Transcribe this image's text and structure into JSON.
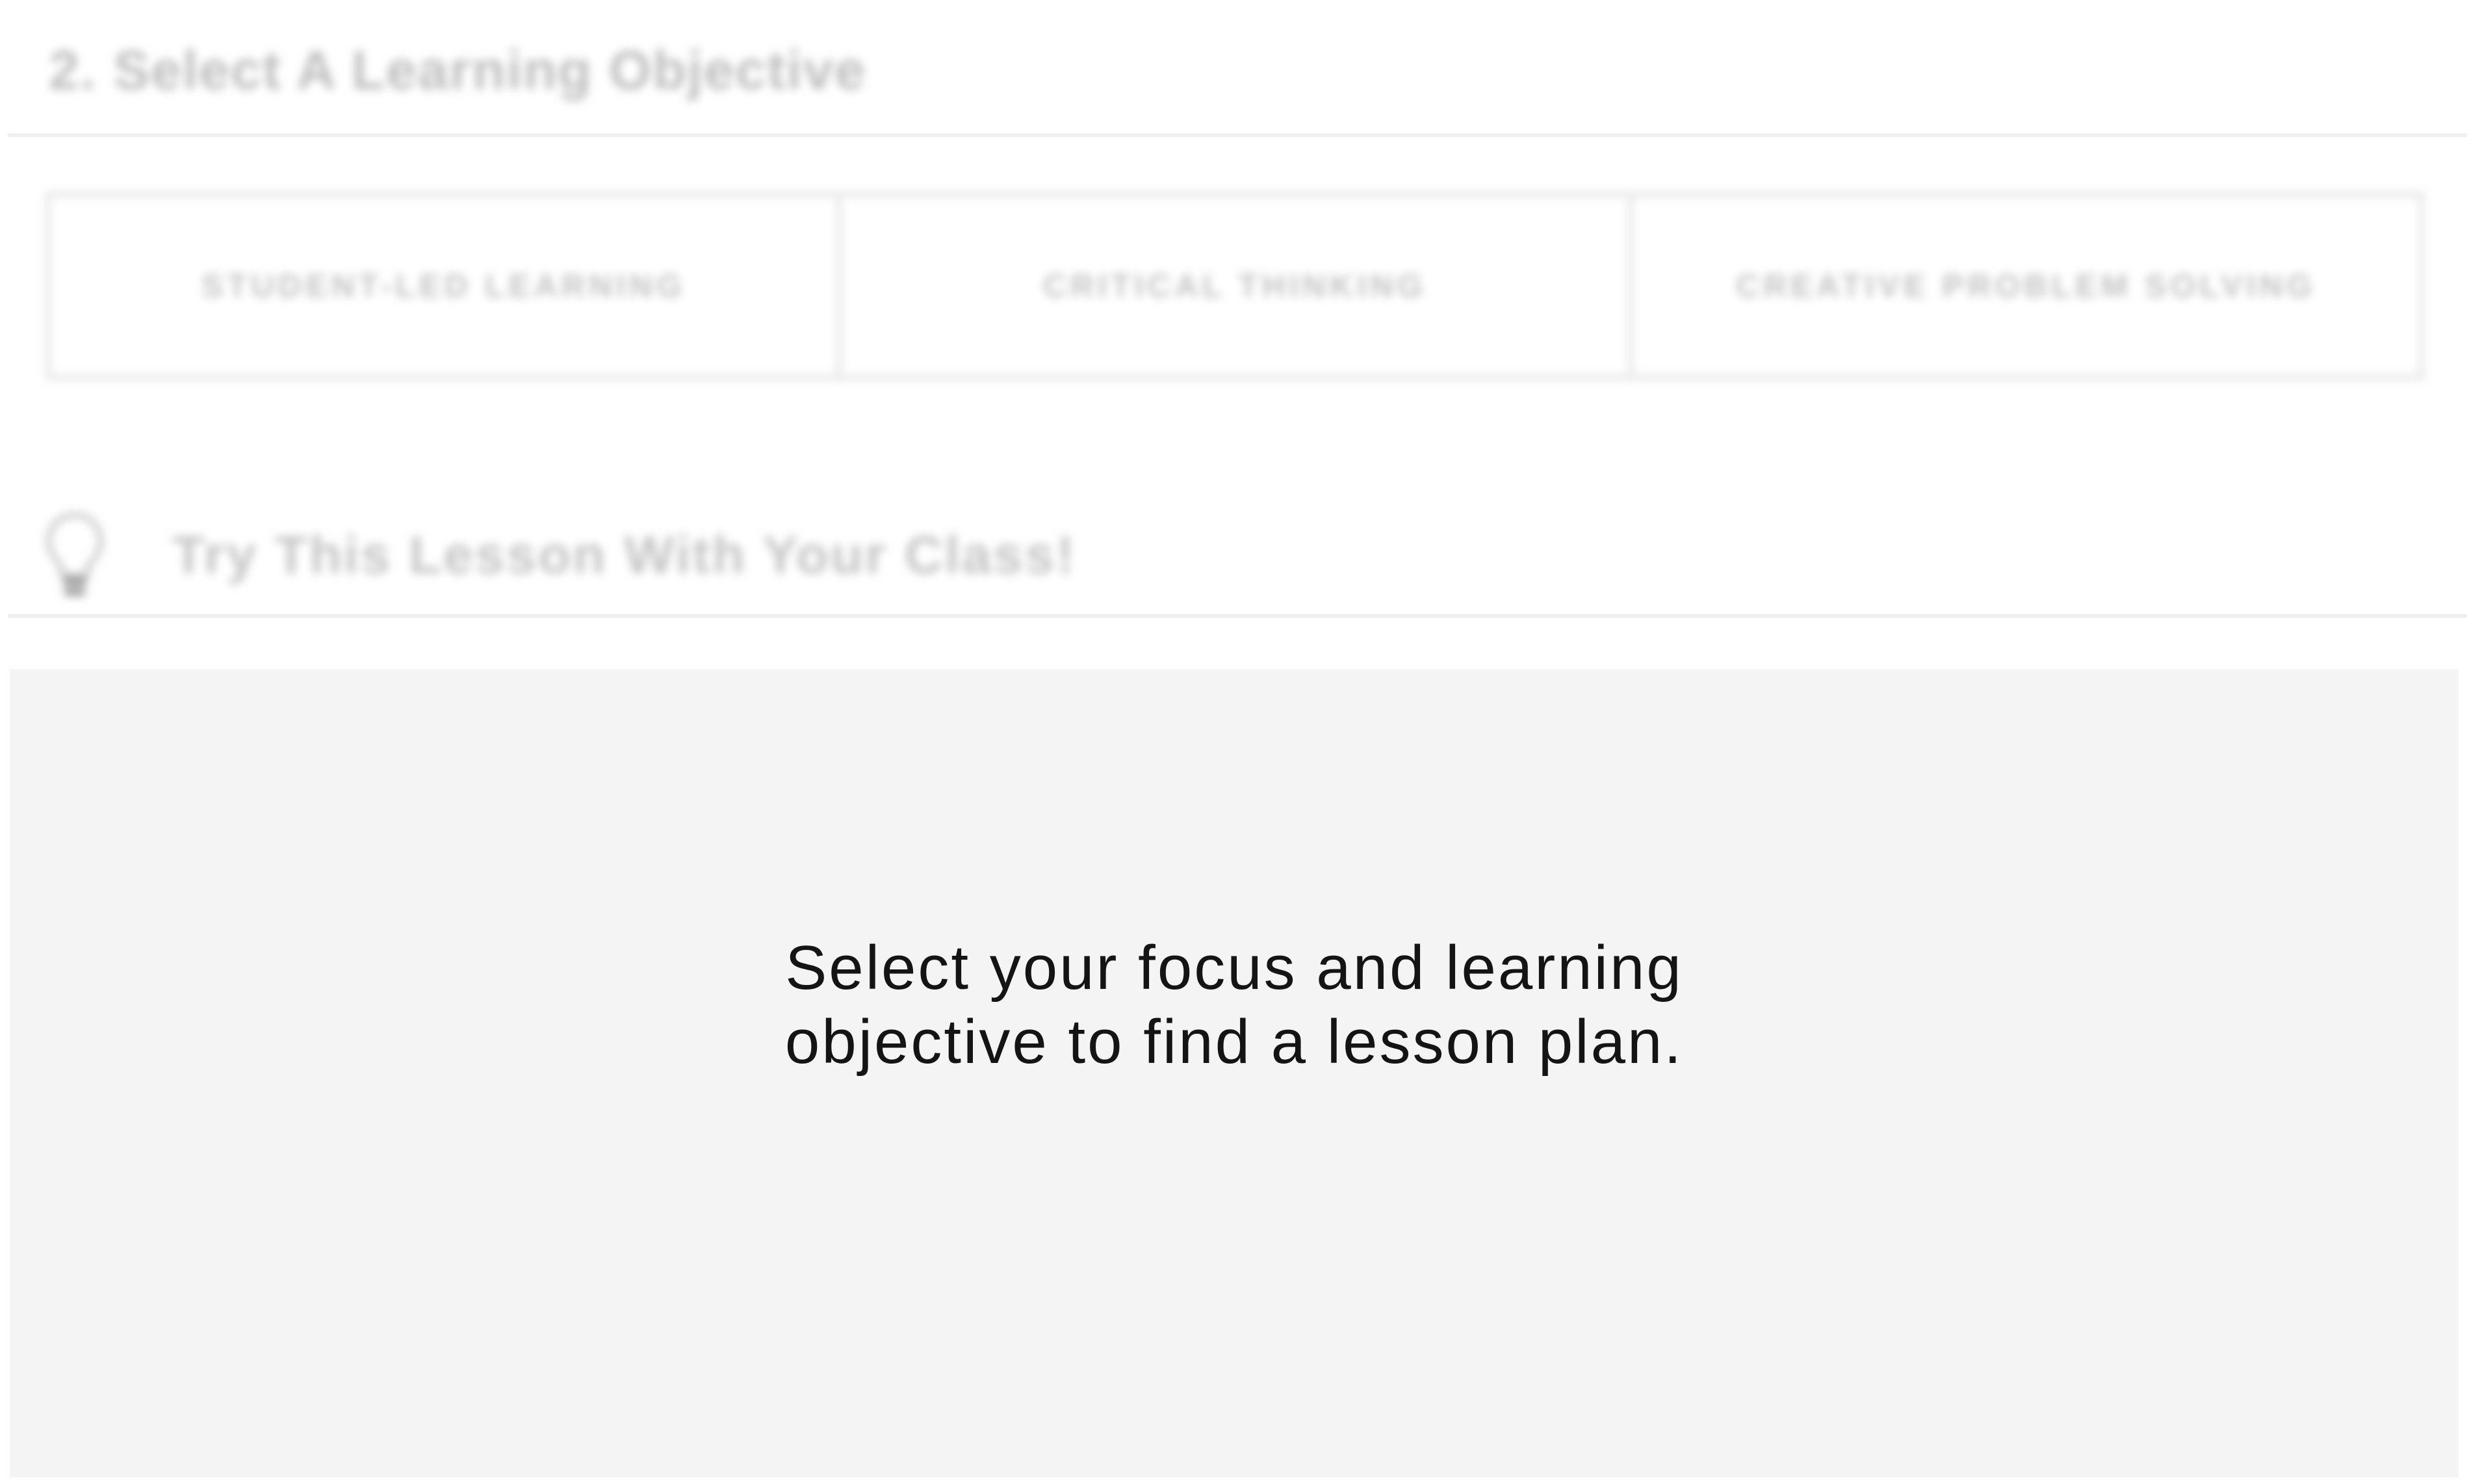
{
  "objective_section": {
    "title": "2. Select A Learning Objective",
    "options": [
      {
        "label": "STUDENT-LED LEARNING"
      },
      {
        "label": "CRITICAL THINKING"
      },
      {
        "label": "CREATIVE PROBLEM SOLVING"
      }
    ]
  },
  "lesson_section": {
    "icon": "lightbulb-icon",
    "title": "Try This Lesson With Your Class!",
    "placeholder_lines": [
      "Select your focus and learning",
      "objective to find a lesson plan."
    ]
  },
  "colors": {
    "panel_background": "#f4f4f4",
    "border": "#e6e6e6",
    "muted_text": "#c2c2c2",
    "message_text": "#141414"
  }
}
